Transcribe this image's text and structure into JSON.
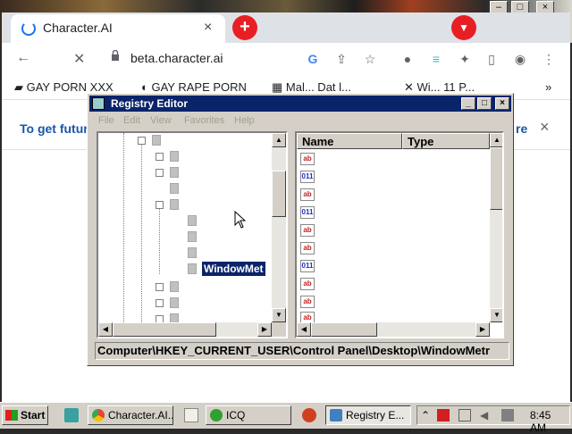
{
  "browser": {
    "tab_title": "Character.AI",
    "tab_close": "×",
    "new_tab": "+",
    "address": "beta.character.ai",
    "bookmarks": [
      {
        "label": "GAY PORN XXX"
      },
      {
        "label": "GAY RAPE PORN"
      },
      {
        "label": "Mal... Dat l..."
      },
      {
        "label": "Wi... 11 P..."
      }
    ],
    "bookmarks_more": "»",
    "infobar_text": "To get futur",
    "infobar_right": "re",
    "infobar_close": "×",
    "window_controls": {
      "minimize": "–",
      "maximize": "□",
      "close": "×"
    }
  },
  "regedit": {
    "title": "Registry Editor",
    "menu": [
      "File",
      "Edit",
      "View",
      "Favorites",
      "Help"
    ],
    "tree_selected": "WindowMet",
    "columns": {
      "name": "Name",
      "type": "Type"
    },
    "values": [
      {
        "kind": "ab"
      },
      {
        "kind": "bin"
      },
      {
        "kind": "ab"
      },
      {
        "kind": "bin"
      },
      {
        "kind": "ab"
      },
      {
        "kind": "ab"
      },
      {
        "kind": "bin"
      },
      {
        "kind": "ab"
      },
      {
        "kind": "ab"
      },
      {
        "kind": "ab"
      }
    ],
    "status_path": "Computer\\HKEY_CURRENT_USER\\Control Panel\\Desktop\\WindowMetr"
  },
  "taskbar": {
    "start_label": "Start",
    "tasks": [
      {
        "label": "Character.AI..."
      },
      {
        "label": "ICQ"
      },
      {
        "label": "Registry E..."
      }
    ],
    "clock": "8:45 AM"
  },
  "colors": {
    "chrome_accent": "#1a73e8",
    "red_button": "#e81e25",
    "regedit_titlebar": "#0a246a",
    "infobar_text": "#1a56a8"
  }
}
